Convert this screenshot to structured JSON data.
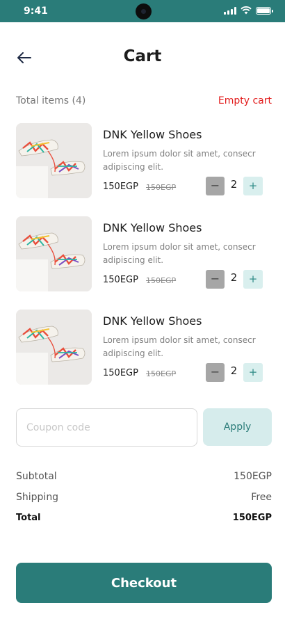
{
  "status_bar": {
    "time": "9:41"
  },
  "header": {
    "title": "Cart"
  },
  "summary": {
    "total_items": "Total items (4)",
    "empty_cart": "Empty cart"
  },
  "items": [
    {
      "name": "DNK Yellow Shoes",
      "description": "Lorem ipsum dolor sit amet, consecr adipiscing elit.",
      "price": "150EGP",
      "old_price": "150EGP",
      "quantity": "2"
    },
    {
      "name": "DNK Yellow Shoes",
      "description": "Lorem ipsum dolor sit amet, consecr adipiscing elit.",
      "price": "150EGP",
      "old_price": "150EGP",
      "quantity": "2"
    },
    {
      "name": "DNK Yellow Shoes",
      "description": "Lorem ipsum dolor sit amet, consecr adipiscing elit.",
      "price": "150EGP",
      "old_price": "150EGP",
      "quantity": "2"
    }
  ],
  "qty_controls": {
    "minus": "−",
    "plus": "+"
  },
  "coupon": {
    "placeholder": "Coupon code",
    "value": "",
    "apply_label": "Apply"
  },
  "totals": {
    "subtotal_label": "Subtotal",
    "subtotal_value": "150EGP",
    "shipping_label": "Shipping",
    "shipping_value": "Free",
    "total_label": "Total",
    "total_value": "150EGP"
  },
  "checkout": {
    "label": "Checkout"
  },
  "colors": {
    "brand": "#2a7c79",
    "danger": "#e21b1b",
    "accent_light": "#d6ecec",
    "minus_gray": "#a6a6a6"
  },
  "icons": {
    "back": "arrow-left-icon",
    "signal": "signal-icon",
    "wifi": "wifi-icon",
    "battery": "battery-icon",
    "product": "sneaker-photo"
  }
}
